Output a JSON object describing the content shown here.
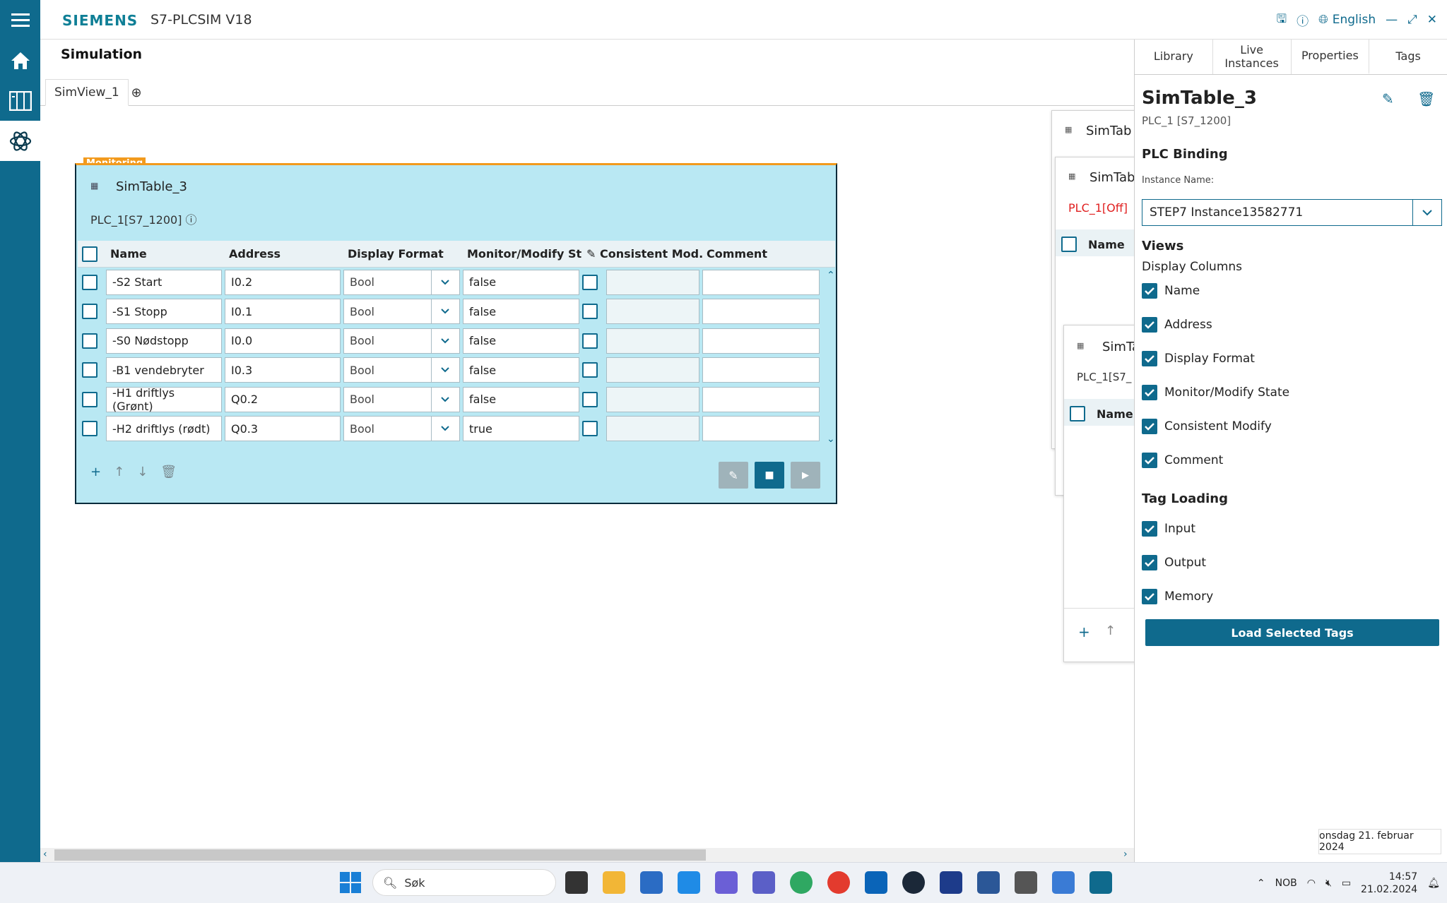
{
  "app": {
    "brand": "SIEMENS",
    "product": "S7-PLCSIM V18",
    "language": "English"
  },
  "page": {
    "title": "Simulation",
    "tab": "SimView_1"
  },
  "widget": {
    "badge": "Monitoring",
    "title": "SimTable_3",
    "subtitle": "PLC_1[S7_1200]",
    "columns": [
      "Name",
      "Address",
      "Display Format",
      "Monitor/Modify St...",
      "Consistent Mod...",
      "Comment"
    ],
    "rows": [
      {
        "name": "-S2 Start",
        "address": "I0.2",
        "format": "Bool",
        "state": "false"
      },
      {
        "name": "-S1 Stopp",
        "address": "I0.1",
        "format": "Bool",
        "state": "false"
      },
      {
        "name": "-S0 Nødstopp",
        "address": "I0.0",
        "format": "Bool",
        "state": "false"
      },
      {
        "name": "-B1 vendebryter",
        "address": "I0.3",
        "format": "Bool",
        "state": "false"
      },
      {
        "name": "-H1 driftlys (Grønt)",
        "address": "Q0.2",
        "format": "Bool",
        "state": "false"
      },
      {
        "name": "-H2 driftlys (rødt)",
        "address": "Q0.3",
        "format": "Bool",
        "state": "true"
      }
    ]
  },
  "bg_tables": {
    "t1_title": "SimTab",
    "t2_title": "SimTab",
    "t2_plc": "PLC_1[Off]",
    "t2_col": "Name",
    "t3_title": "SimTa",
    "t3_plc": "PLC_1[S7_",
    "t3_col": "Name"
  },
  "panel": {
    "tabs": [
      "Library",
      "Live\nInstances",
      "Properties",
      "Tags"
    ],
    "title": "SimTable_3",
    "subtitle": "PLC_1 [S7_1200]",
    "plc_binding": "PLC Binding",
    "instance_label": "Instance Name:",
    "instance_value": "STEP7 Instance13582771",
    "views": "Views",
    "display_columns": "Display Columns",
    "columns": [
      "Name",
      "Address",
      "Display Format",
      "Monitor/Modify State",
      "Consistent Modify",
      "Comment"
    ],
    "tag_loading": "Tag Loading",
    "tags": [
      "Input",
      "Output",
      "Memory"
    ],
    "load_button": "Load Selected Tags"
  },
  "datepop": "onsdag 21. februar 2024",
  "taskbar": {
    "search": "Søk",
    "lang": "NOB",
    "time": "14:57",
    "date": "21.02.2024"
  },
  "colors": {
    "accent": "#0f6a8d",
    "widget_bg": "#b9e8f3",
    "monitor_badge": "#f29a1d",
    "error": "#e02020"
  }
}
